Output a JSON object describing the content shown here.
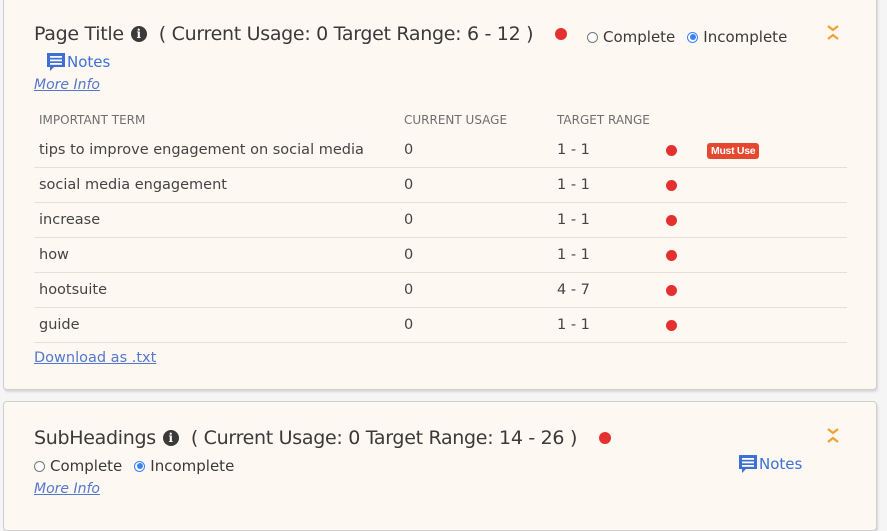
{
  "sections": [
    {
      "title": "Page Title",
      "usage_text": "( Current Usage: 0 Target Range: 6 - 12 )",
      "status_color": "#e53030",
      "radio": {
        "complete_label": "Complete",
        "incomplete_label": "Incomplete",
        "selected": "Incomplete"
      },
      "notes_label": "Notes",
      "more_info_label": "More Info",
      "table": {
        "headers": [
          "IMPORTANT TERM",
          "CURRENT USAGE",
          "TARGET RANGE"
        ],
        "rows": [
          {
            "term": "tips to improve engagement on social media",
            "usage": "0",
            "range": "1 - 1",
            "badge": "Must Use"
          },
          {
            "term": "social media engagement",
            "usage": "0",
            "range": "1 - 1",
            "badge": ""
          },
          {
            "term": "increase",
            "usage": "0",
            "range": "1 - 1",
            "badge": ""
          },
          {
            "term": "how",
            "usage": "0",
            "range": "1 - 1",
            "badge": ""
          },
          {
            "term": "hootsuite",
            "usage": "0",
            "range": "4 - 7",
            "badge": ""
          },
          {
            "term": "guide",
            "usage": "0",
            "range": "1 - 1",
            "badge": ""
          }
        ]
      },
      "download_label": "Download as .txt"
    },
    {
      "title": "SubHeadings",
      "usage_text": "( Current Usage: 0 Target Range: 14 - 26 )",
      "status_color": "#e53030",
      "radio": {
        "complete_label": "Complete",
        "incomplete_label": "Incomplete",
        "selected": "Incomplete"
      },
      "notes_label": "Notes",
      "more_info_label": "More Info"
    }
  ],
  "icons": {
    "info": "info-circle-icon",
    "notes": "comment-lines-icon",
    "collapse": "collapse-chevrons-icon",
    "status": "red-status-dot"
  },
  "colors": {
    "card_bg": "#fdf8f2",
    "link": "#5577cc",
    "notes": "#3d6fd6",
    "status_red": "#e53030",
    "badge": "#e4492f",
    "accent_orange": "#f0a030",
    "radio_selected": "#3b82f6"
  }
}
